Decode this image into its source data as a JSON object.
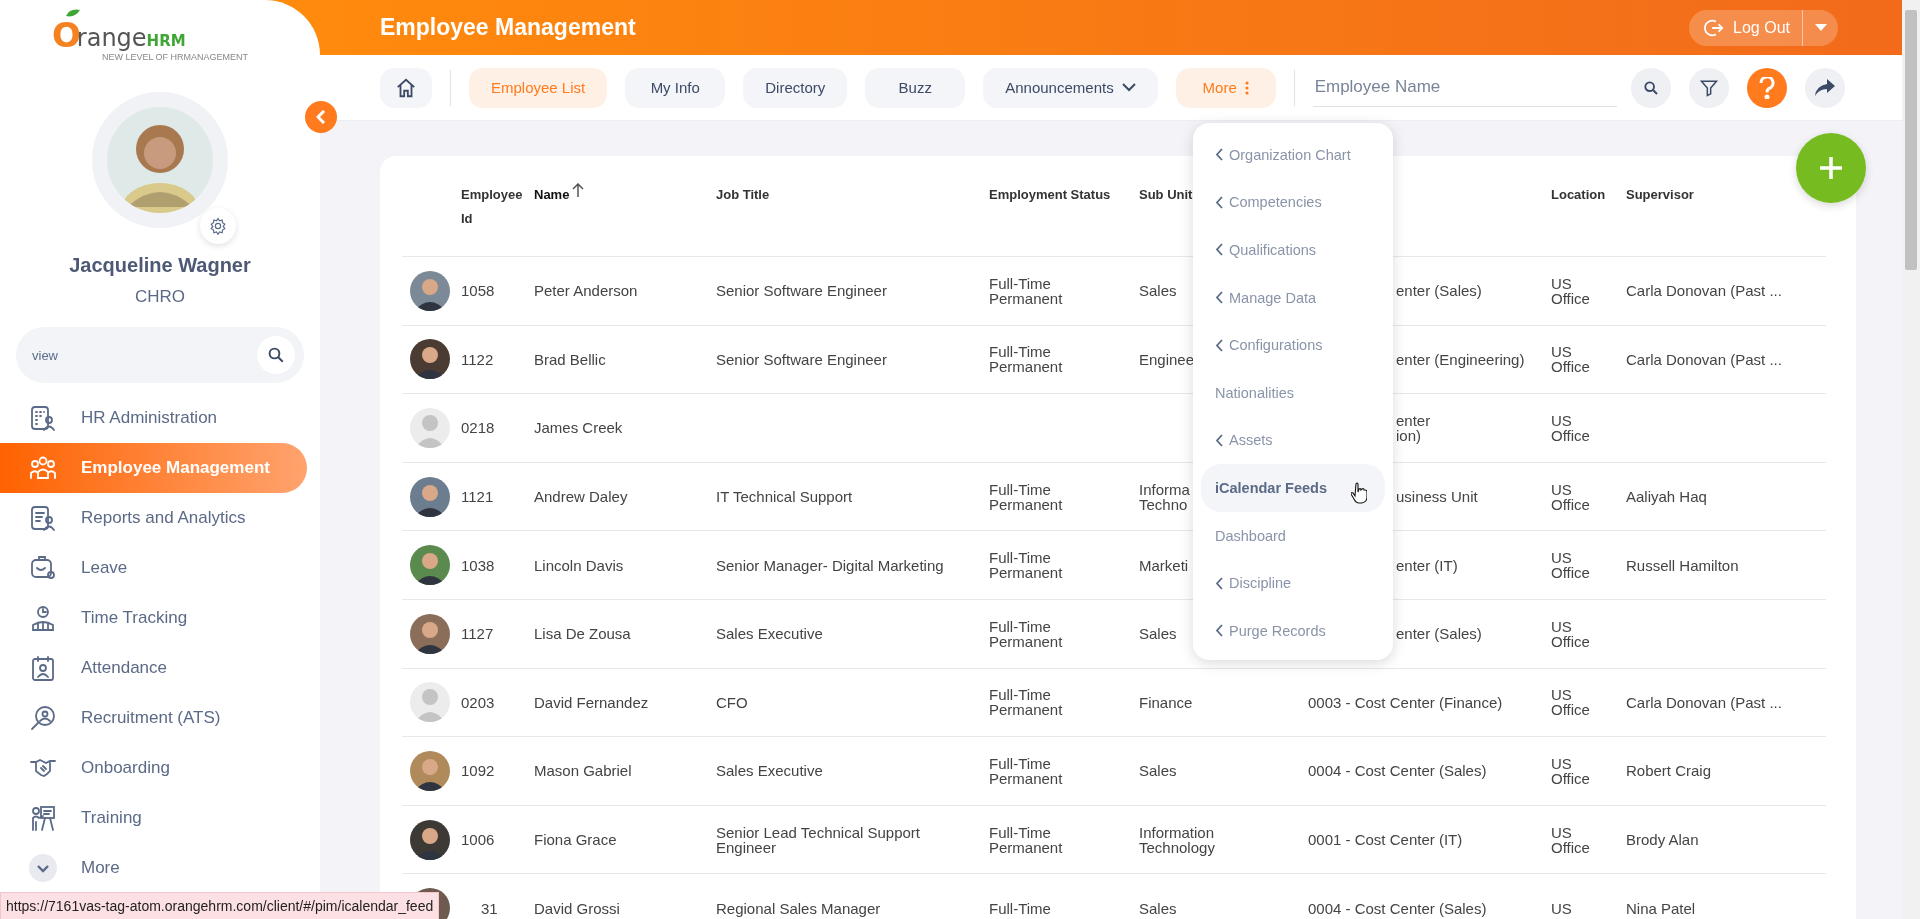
{
  "logo": {
    "mark": "O",
    "word": "range",
    "suffix": "HRM",
    "tagline": "NEW LEVEL OF HRMANAGEMENT"
  },
  "profile": {
    "name": "Jacqueline Wagner",
    "role": "CHRO"
  },
  "sidebar_search": {
    "value": "view"
  },
  "sidebar": {
    "items": [
      {
        "label": "HR Administration",
        "selected": false
      },
      {
        "label": "Employee Management",
        "selected": true
      },
      {
        "label": "Reports and Analytics",
        "selected": false
      },
      {
        "label": "Leave",
        "selected": false
      },
      {
        "label": "Time Tracking",
        "selected": false
      },
      {
        "label": "Attendance",
        "selected": false
      },
      {
        "label": "Recruitment (ATS)",
        "selected": false
      },
      {
        "label": "Onboarding",
        "selected": false
      },
      {
        "label": "Training",
        "selected": false
      }
    ],
    "more": "More"
  },
  "header": {
    "title": "Employee Management",
    "logout": "Log Out"
  },
  "tabs": [
    {
      "label": "Employee List",
      "selected": true,
      "kind": "plain"
    },
    {
      "label": "My Info",
      "selected": false,
      "kind": "plain"
    },
    {
      "label": "Directory",
      "selected": false,
      "kind": "plain"
    },
    {
      "label": "Buzz",
      "selected": false,
      "kind": "plain"
    },
    {
      "label": "Announcements",
      "selected": false,
      "kind": "dropdown"
    },
    {
      "label": "More",
      "selected": true,
      "kind": "more"
    }
  ],
  "search": {
    "placeholder": "Employee Name"
  },
  "more_menu": {
    "items": [
      {
        "label": "Organization Chart",
        "kind": "submenu",
        "highlighted": false
      },
      {
        "label": "Competencies",
        "kind": "submenu",
        "highlighted": false
      },
      {
        "label": "Qualifications",
        "kind": "submenu",
        "highlighted": false
      },
      {
        "label": "Manage Data",
        "kind": "submenu",
        "highlighted": false
      },
      {
        "label": "Configurations",
        "kind": "submenu",
        "highlighted": false
      },
      {
        "label": "Nationalities",
        "kind": "link",
        "highlighted": false
      },
      {
        "label": "Assets",
        "kind": "submenu",
        "highlighted": false
      },
      {
        "label": "iCalendar Feeds",
        "kind": "link",
        "highlighted": true
      },
      {
        "label": "Dashboard",
        "kind": "link",
        "highlighted": false
      },
      {
        "label": "Discipline",
        "kind": "submenu",
        "highlighted": false
      },
      {
        "label": "Purge Records",
        "kind": "submenu",
        "highlighted": false
      }
    ]
  },
  "table": {
    "columns": [
      {
        "label": "Employee Id",
        "sorted": false
      },
      {
        "label": "Name",
        "sorted": true
      },
      {
        "label": "Job Title",
        "sorted": false
      },
      {
        "label": "Employment Status",
        "sorted": false
      },
      {
        "label": "Sub Unit",
        "sorted": false
      },
      {
        "label": "Location",
        "sorted": false
      },
      {
        "label": "Supervisor",
        "sorted": false
      }
    ],
    "rows": [
      {
        "photo": true,
        "id": "1058",
        "name": "Peter Anderson",
        "job_title": "Senior Software Engineer",
        "status": "Full-Time Permanent",
        "sub_unit": "Sales",
        "cost_center": "enter (Sales)",
        "covered": true,
        "location": "US Office",
        "supervisor": "Carla Donovan (Past ..."
      },
      {
        "photo": true,
        "id": "1122",
        "name": "Brad Bellic",
        "job_title": "Senior Software Engineer",
        "status": "Full-Time Permanent",
        "sub_unit": "Enginee",
        "cost_center": "enter (Engineering)",
        "covered": true,
        "location": "US Office",
        "supervisor": "Carla Donovan (Past ..."
      },
      {
        "photo": false,
        "id": "0218",
        "name": "James Creek",
        "cost_center": "enter\nion)",
        "covered": true,
        "location": "US Office"
      },
      {
        "photo": true,
        "id": "1121",
        "name": "Andrew Daley",
        "job_title": "IT Technical Support",
        "status": "Full-Time Permanent",
        "sub_unit": "Informa Techno",
        "cost_center": "usiness Unit",
        "covered": true,
        "location": "US Office",
        "supervisor": "Aaliyah Haq"
      },
      {
        "photo": true,
        "id": "1038",
        "name": "Lincoln Davis",
        "job_title": "Senior Manager- Digital Marketing",
        "status": "Full-Time Permanent",
        "sub_unit": "Marketi",
        "cost_center": "enter (IT)",
        "covered": true,
        "location": "US Office",
        "supervisor": "Russell Hamilton"
      },
      {
        "photo": true,
        "id": "1127",
        "name": "Lisa De Zousa",
        "job_title": "Sales Executive",
        "status": "Full-Time Permanent",
        "sub_unit": "Sales",
        "cost_center": "enter (Sales)",
        "covered": true,
        "location": "US Office"
      },
      {
        "photo": false,
        "id": "0203",
        "name": "David Fernandez",
        "job_title": "CFO",
        "status": "Full-Time Permanent",
        "sub_unit": "Finance",
        "cost_center": "0003 - Cost Center (Finance)",
        "covered": false,
        "location": "US Office",
        "supervisor": "Carla Donovan (Past ..."
      },
      {
        "photo": true,
        "id": "1092",
        "name": "Mason Gabriel",
        "job_title": "Sales Executive",
        "status": "Full-Time Permanent",
        "sub_unit": "Sales",
        "cost_center": "0004 - Cost Center (Sales)",
        "covered": false,
        "location": "US Office",
        "supervisor": "Robert Craig"
      },
      {
        "photo": true,
        "id": "1006",
        "name": "Fiona Grace",
        "job_title": "Senior Lead Technical Support Engineer",
        "status": "Full-Time Permanent",
        "sub_unit": "Information Technology",
        "cost_center": "0001 - Cost Center (IT)",
        "covered": false,
        "location": "US Office",
        "supervisor": "Brody Alan"
      },
      {
        "photo": true,
        "id": "31",
        "name": "David Grossi",
        "job_title": "Regional Sales Manager",
        "status": "Full-Time",
        "sub_unit": "Sales",
        "cost_center": "0004 - Cost Center (Sales)",
        "covered": false,
        "location": "US",
        "supervisor": "Nina Patel"
      }
    ]
  },
  "status_bar": {
    "url": "https://7161vas-tag-atom.orangehrm.com/client/#/pim/icalendar_feed"
  }
}
